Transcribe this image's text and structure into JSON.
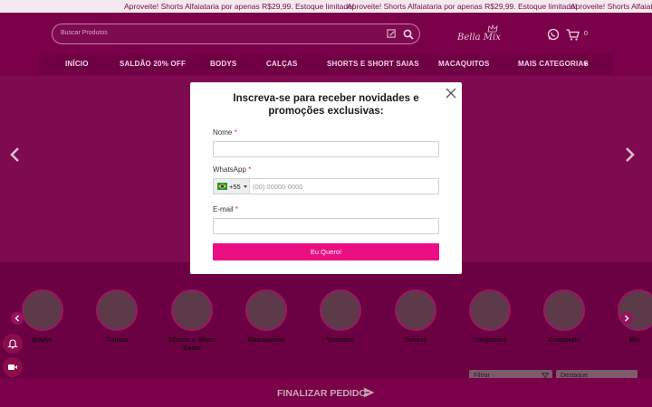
{
  "ticker": {
    "messages": [
      "Aproveite! Shorts Alfaiataria por apenas R$29,99. Estoque limitado!",
      "Aproveite! Shorts Alfaiataria por apenas R$29,99. Estoque limitado!",
      "Aproveite! Shorts Alfaiata"
    ]
  },
  "header": {
    "search_placeholder": "Buscar Produtos",
    "logo_text": "Bella Mix",
    "cart_count": "0"
  },
  "nav": {
    "items": [
      "INÍCIO",
      "SALDÃO 20% OFF",
      "BODYS",
      "CALÇAS",
      "SHORTS E SHORT SAIAS",
      "MACAQUITOS",
      "MAIS CATEGORIAS"
    ]
  },
  "categories": {
    "items": [
      {
        "label": "Bodys"
      },
      {
        "label": "Calças"
      },
      {
        "label": "Shorts e Short Saias"
      },
      {
        "label": "Macaquitos"
      },
      {
        "label": "Vestidos"
      },
      {
        "label": "Tshirts"
      },
      {
        "label": "Conjuntos"
      },
      {
        "label": "Croppeds"
      },
      {
        "label": "Blu"
      }
    ]
  },
  "filters": {
    "filter_label": "Filtrar",
    "sort_label": "Destaque"
  },
  "footer_bar": {
    "finalizar_label": "FINALIZAR PEDIDO"
  },
  "modal": {
    "title": "Inscreva-se para receber novidades e promoções exclusivas:",
    "name_label": "Nome",
    "whatsapp_label": "WhatsApp",
    "country_code": "+55",
    "phone_placeholder": "(00) 00000-0000",
    "email_label": "E-mail",
    "required_mark": "*",
    "submit_label": "Eu Quero!"
  },
  "colors": {
    "brand": "#ec0f83",
    "header_bg": "#7a004a",
    "overlay_page": "#6b0042"
  },
  "icons": [
    "close-icon",
    "search-icon",
    "edit-icon",
    "whatsapp-icon",
    "cart-icon",
    "chevron-left-icon",
    "chevron-right-icon",
    "bell-icon",
    "video-icon",
    "send-icon",
    "brazil-flag-icon"
  ]
}
